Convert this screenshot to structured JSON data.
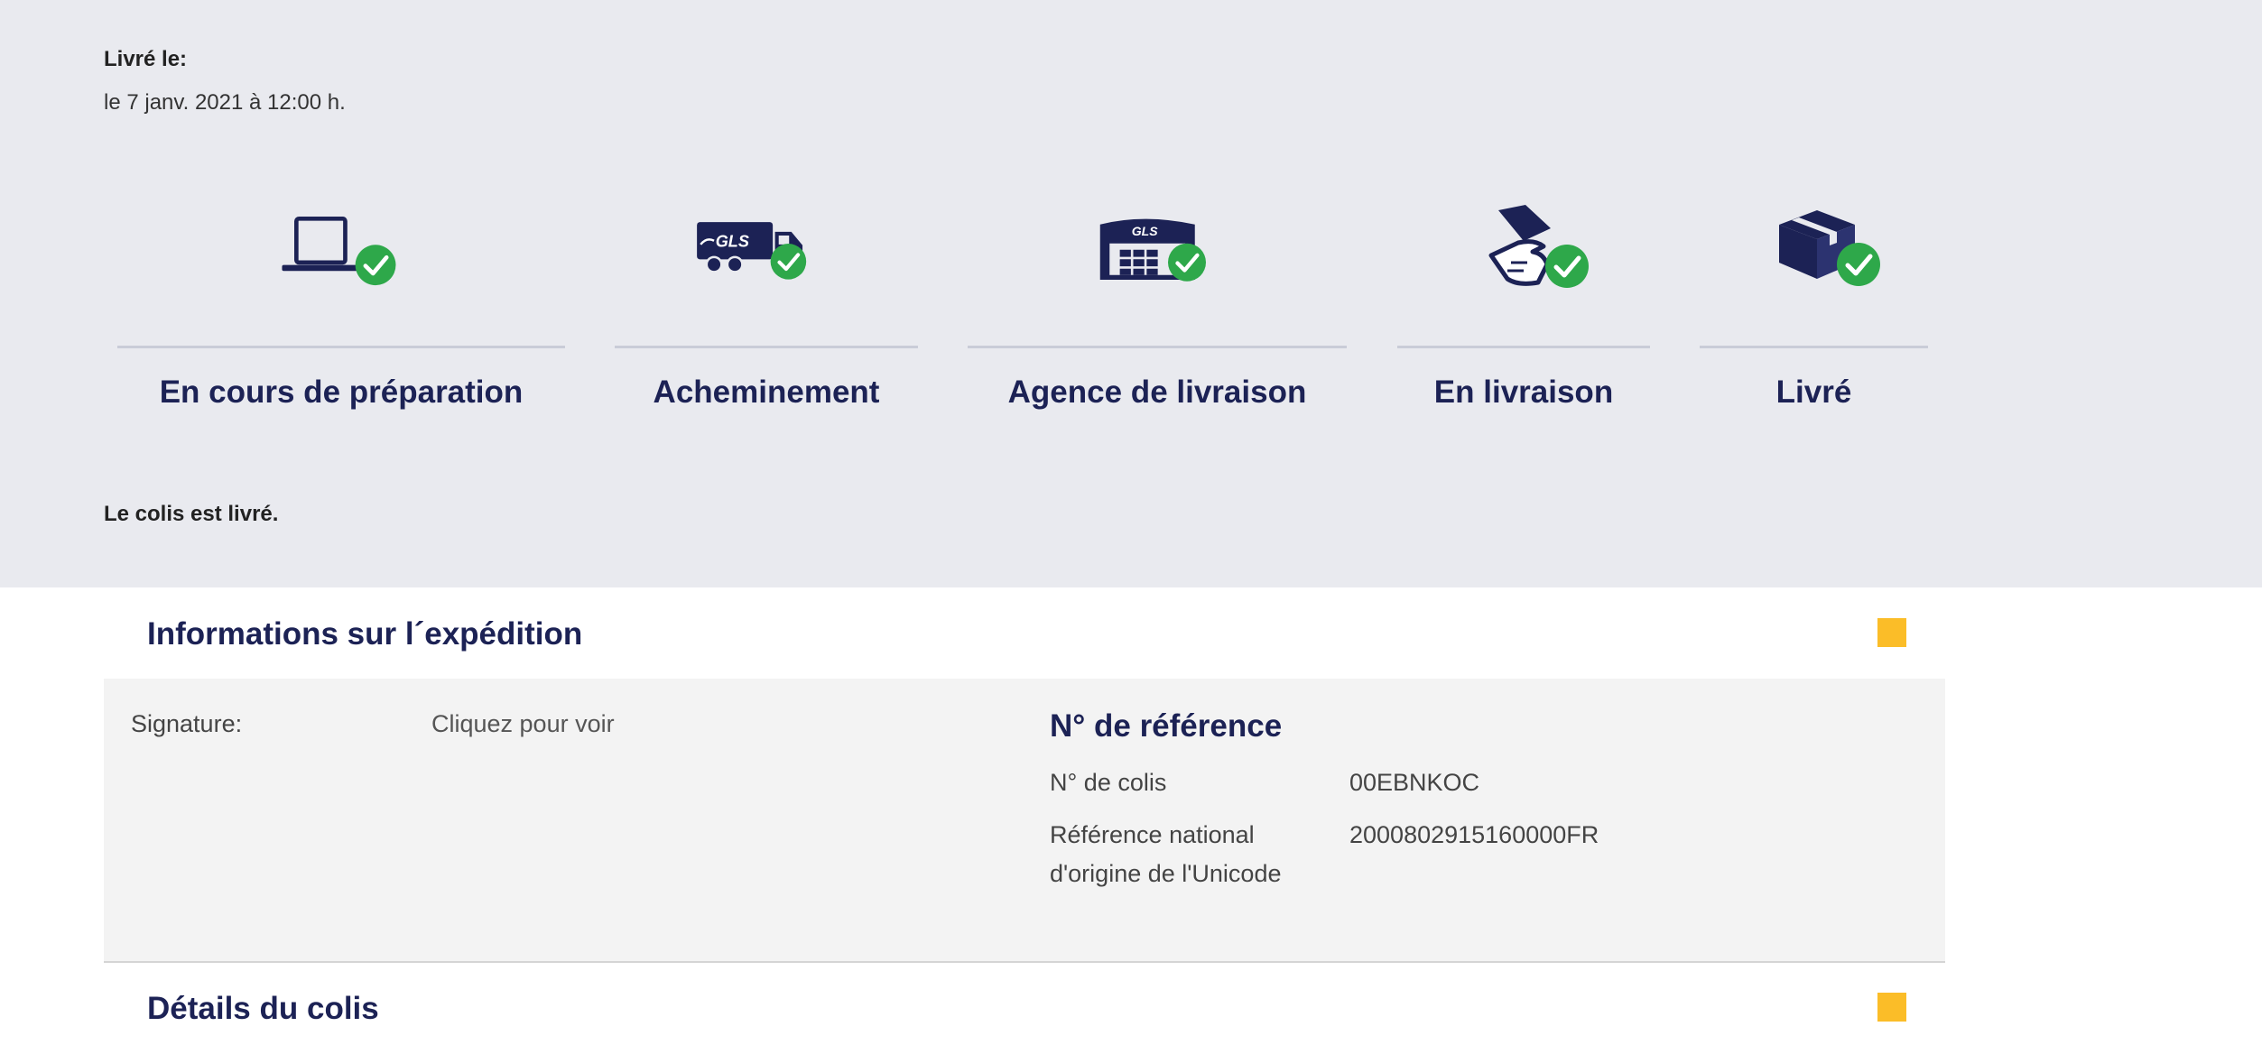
{
  "delivery": {
    "label": "Livré le:",
    "date": "le 7 janv. 2021 à 12:00 h."
  },
  "steps": [
    {
      "label": "En cours de préparation",
      "icon": "laptop-icon"
    },
    {
      "label": "Acheminement",
      "icon": "gls-truck-icon"
    },
    {
      "label": "Agence de livraison",
      "icon": "gls-depot-icon"
    },
    {
      "label": "En livraison",
      "icon": "hand-delivery-icon"
    },
    {
      "label": "Livré",
      "icon": "package-icon"
    }
  ],
  "brand_text": "GLS",
  "status_message": "Le colis est livré.",
  "shipment_info": {
    "title": "Informations sur l´expédition",
    "signature_label": "Signature:",
    "signature_link": "Cliquez pour voir",
    "reference_title": "N° de référence",
    "parcel_no_label": "N° de colis",
    "parcel_no_value": "00EBNKOC",
    "national_ref_label_line1": "Référence national",
    "national_ref_label_line2": "d'origine de l'Unicode",
    "national_ref_value": "2000802915160000FR"
  },
  "parcel_details": {
    "title": "Détails du colis"
  },
  "colors": {
    "panel_bg": "#e9eaef",
    "navy": "#1c2255",
    "check_green": "#2ea84a",
    "marker_yellow": "#fbbd28"
  }
}
